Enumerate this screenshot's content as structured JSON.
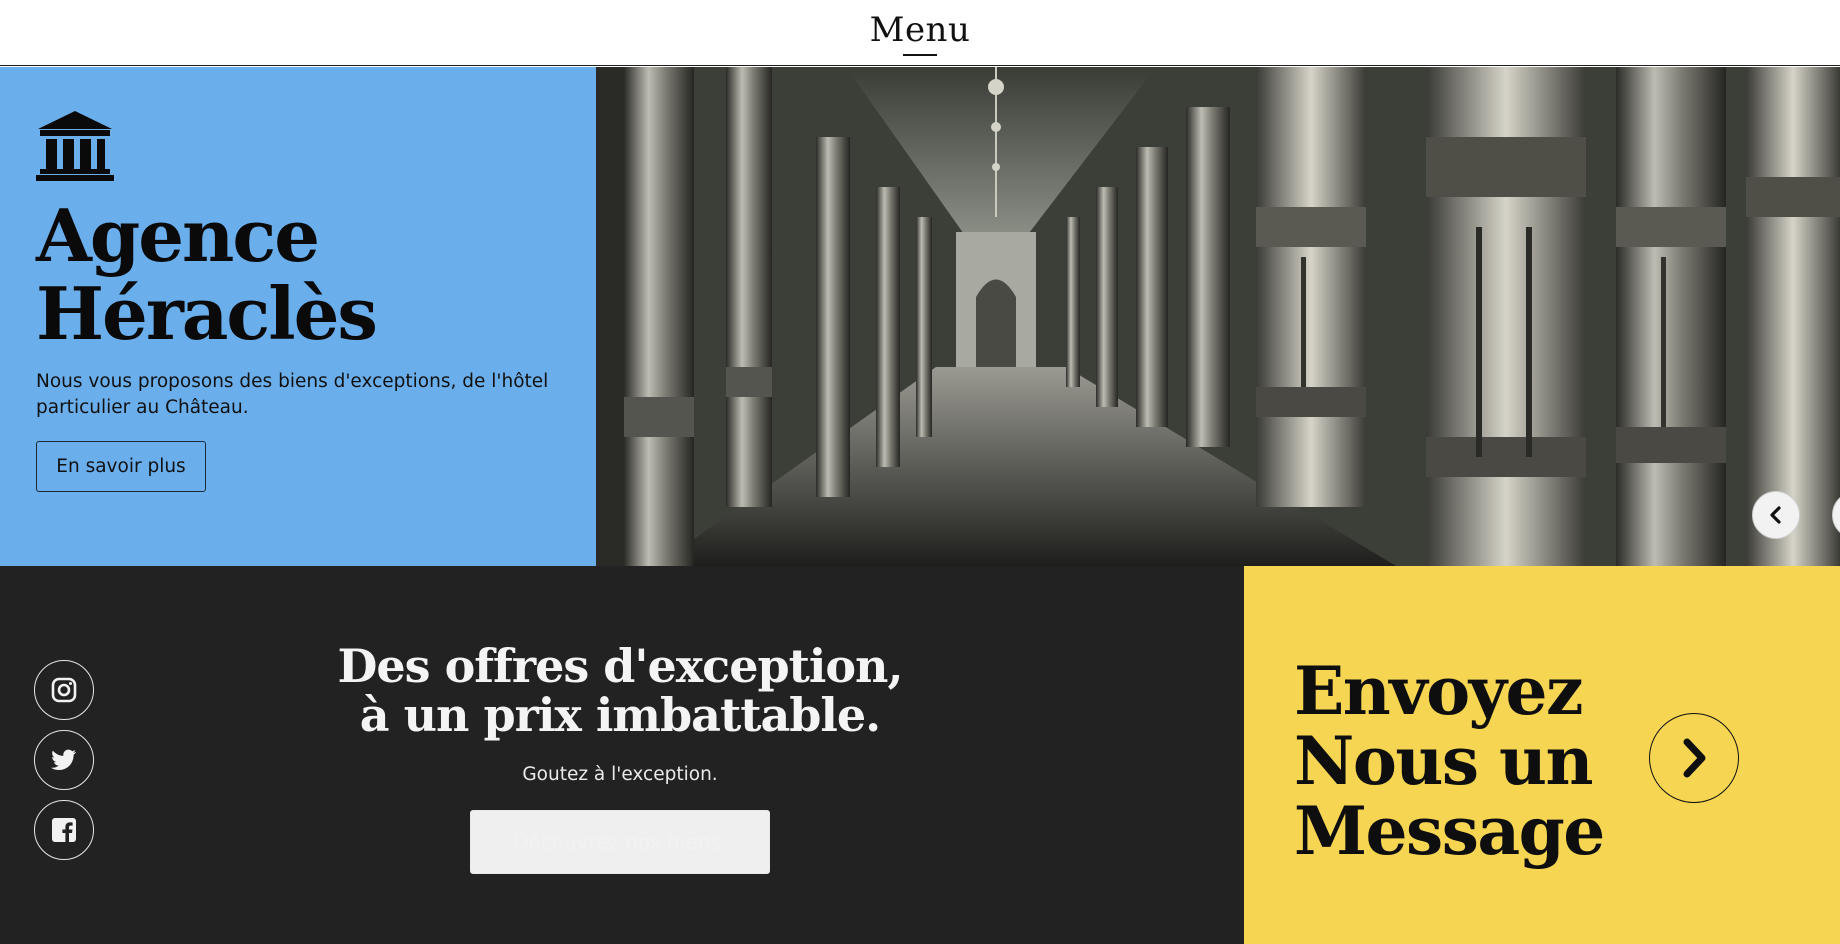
{
  "header": {
    "menu_label": "Menu"
  },
  "hero": {
    "icon": "bank-building-icon",
    "title_line1": "Agence",
    "title_line2": "Héraclès",
    "description": "Nous vous proposons des biens d'exceptions, de l'hôtel particulier au Château.",
    "button_label": "En savoir plus",
    "image_icon": "palace-colonnade-photo",
    "prev_icon": "chevron-left-icon",
    "next_icon": "chevron-right-icon"
  },
  "offers": {
    "title_line1": "Des offres d'exception,",
    "title_line2": "à un prix imbattable.",
    "subtitle": "Goutez à l'exception.",
    "button_label": "Découvrez nos biens.",
    "social": [
      "instagram-icon",
      "twitter-icon",
      "facebook-icon"
    ]
  },
  "contact": {
    "title_line1": "Envoyez",
    "title_line2": "Nous un",
    "title_line3": "Message",
    "arrow_icon": "chevron-right-icon"
  },
  "colors": {
    "hero_blue": "#6aaeec",
    "dark": "#222222",
    "yellow": "#f5d552"
  }
}
